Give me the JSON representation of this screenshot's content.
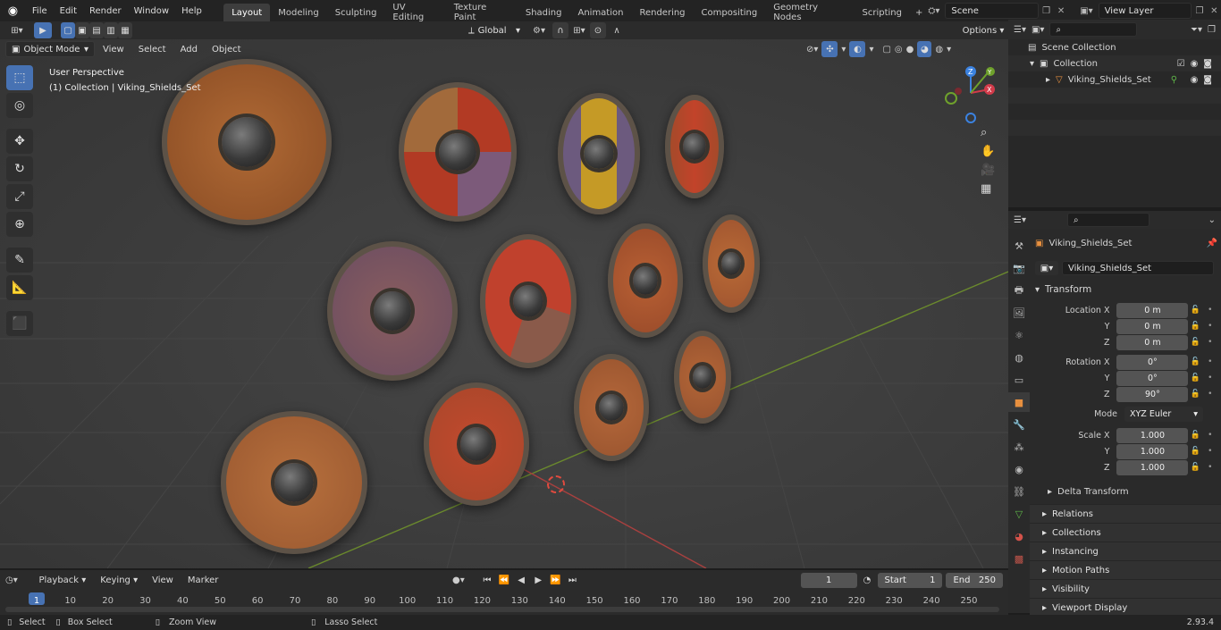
{
  "menus": [
    "File",
    "Edit",
    "Render",
    "Window",
    "Help"
  ],
  "workspaces": [
    "Layout",
    "Modeling",
    "Sculpting",
    "UV Editing",
    "Texture Paint",
    "Shading",
    "Animation",
    "Rendering",
    "Compositing",
    "Geometry Nodes",
    "Scripting"
  ],
  "active_workspace": "Layout",
  "scene": "Scene",
  "view_layer": "View Layer",
  "viewport": {
    "mode": "Object Mode",
    "menus": [
      "View",
      "Select",
      "Add",
      "Object"
    ],
    "transform_orientation": "Global",
    "options": "Options",
    "overlay_title": "User Perspective",
    "overlay_subtitle": "(1) Collection | Viking_Shields_Set"
  },
  "outliner": {
    "scene_collection": "Scene Collection",
    "collection": "Collection",
    "object": "Viking_Shields_Set"
  },
  "properties": {
    "object_name": "Viking_Shields_Set",
    "data_name": "Viking_Shields_Set",
    "transform_title": "Transform",
    "location_label": "Location X",
    "loc_x": "0 m",
    "loc_y": "0 m",
    "loc_z": "0 m",
    "rotation_label": "Rotation X",
    "rot_x": "0°",
    "rot_y": "0°",
    "rot_z": "90°",
    "mode_label": "Mode",
    "mode_value": "XYZ Euler",
    "scale_label": "Scale X",
    "scale_x": "1.000",
    "scale_y": "1.000",
    "scale_z": "1.000",
    "y_label": "Y",
    "z_label": "Z",
    "delta": "Delta Transform",
    "sections": [
      "Relations",
      "Collections",
      "Instancing",
      "Motion Paths",
      "Visibility",
      "Viewport Display"
    ]
  },
  "timeline": {
    "menus": [
      "Playback",
      "Keying",
      "View",
      "Marker"
    ],
    "current_frame": "1",
    "start_label": "Start",
    "start": "1",
    "end_label": "End",
    "end": "250",
    "ticks": [
      "1",
      "10",
      "20",
      "30",
      "40",
      "50",
      "60",
      "70",
      "80",
      "90",
      "100",
      "110",
      "120",
      "130",
      "140",
      "150",
      "160",
      "170",
      "180",
      "190",
      "200",
      "210",
      "220",
      "230",
      "240",
      "250"
    ]
  },
  "status": {
    "select": "Select",
    "box_select": "Box Select",
    "zoom_view": "Zoom View",
    "lasso_select": "Lasso Select",
    "version": "2.93.4"
  }
}
